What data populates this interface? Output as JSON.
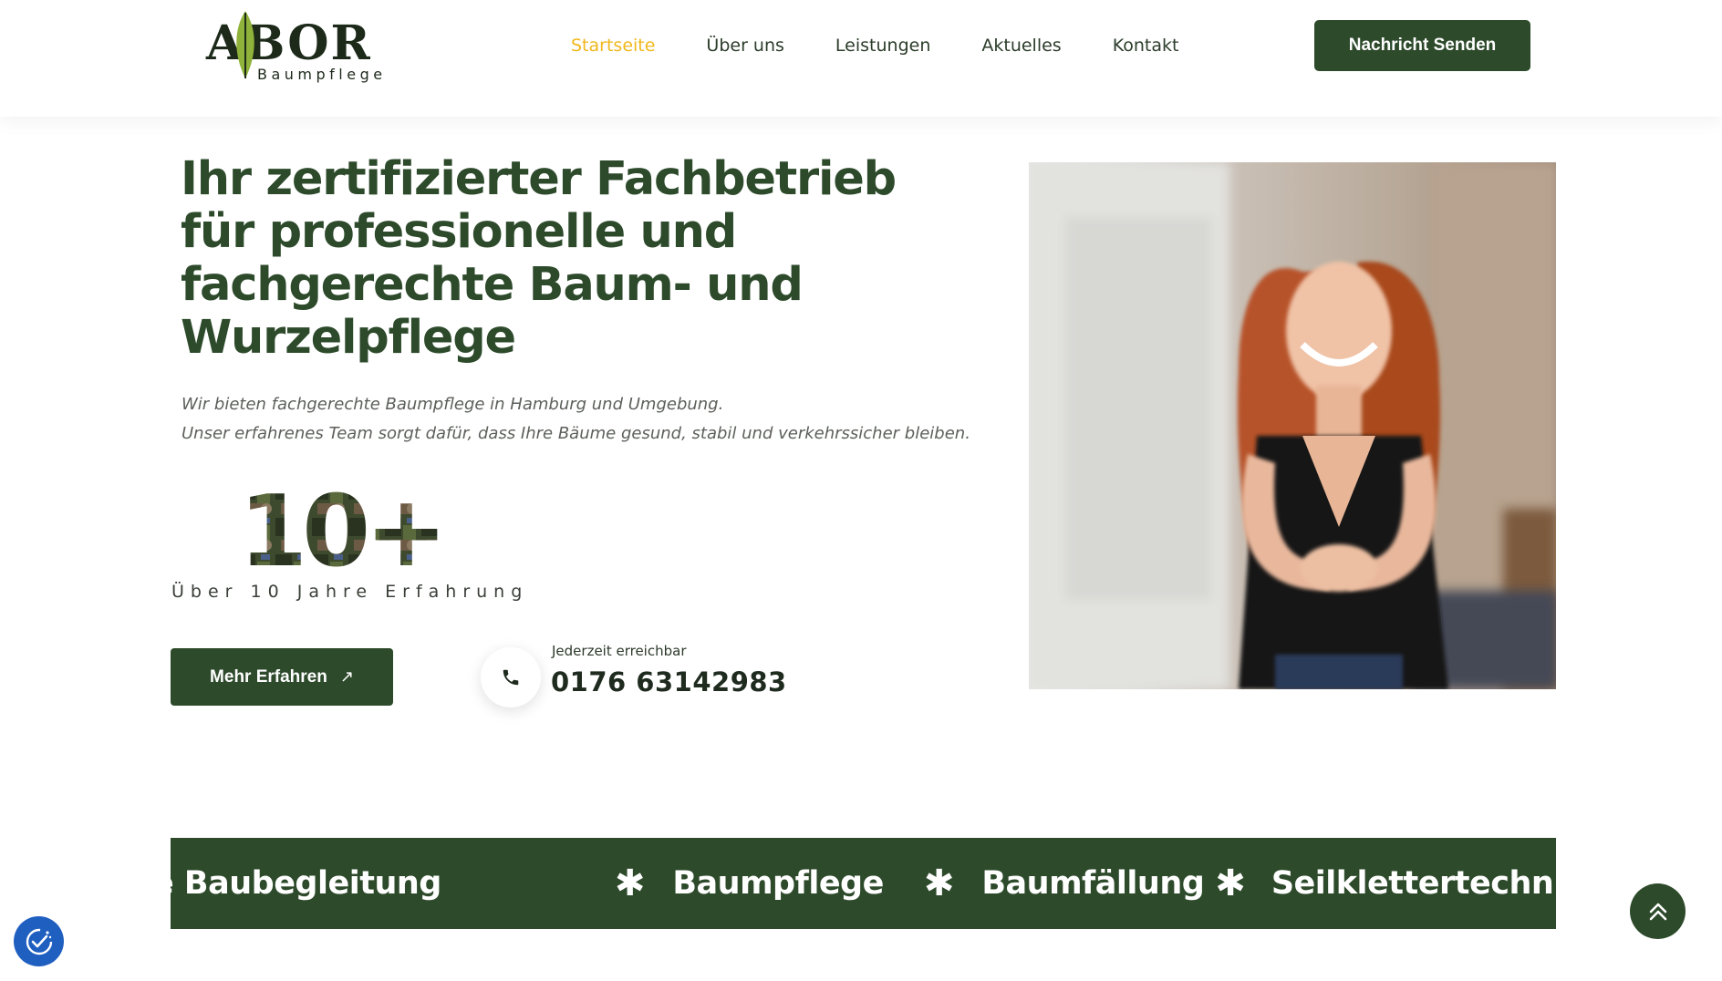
{
  "header": {
    "logo": {
      "wordmark": "ABOR",
      "subtitle": "Baumpflege"
    },
    "nav": [
      {
        "label": "Startseite",
        "active": true
      },
      {
        "label": "Über uns",
        "active": false
      },
      {
        "label": "Leistungen",
        "active": false
      },
      {
        "label": "Aktuelles",
        "active": false
      },
      {
        "label": "Kontakt",
        "active": false
      }
    ],
    "cta_label": "Nachricht Senden"
  },
  "hero": {
    "title": "Ihr zertifizierter Fachbetrieb für professionelle und fachgerechte Baum- und Wurzelpflege",
    "subtitle_lines": [
      "Wir bieten fachgerechte Baumpflege in Hamburg und Umgebung.",
      "Unser erfahrenes Team sorgt dafür, dass Ihre Bäume gesund, stabil und verkehrssicher bleiben."
    ],
    "experience": {
      "value": "10+",
      "label": "Über 10 Jahre Erfahrung"
    },
    "more_button": "Mehr Erfahren",
    "phone": {
      "caption": "Jederzeit erreichbar",
      "number": "0176 63142983"
    }
  },
  "band": {
    "items": [
      "e Baubegleitung",
      "Baumpflege",
      "Baumfällung",
      "Seilklettertechnik"
    ],
    "separator": "✱"
  },
  "colors": {
    "brand_green": "#2d4a2b",
    "accent_yellow": "#f0b81c",
    "cookie_blue": "#1f5fc0"
  },
  "icons": {
    "cta_arrow": "arrow-up-right-icon",
    "phone": "phone-icon",
    "cookie": "cookie-settings-icon",
    "scroll_top": "double-chevron-up-icon"
  }
}
